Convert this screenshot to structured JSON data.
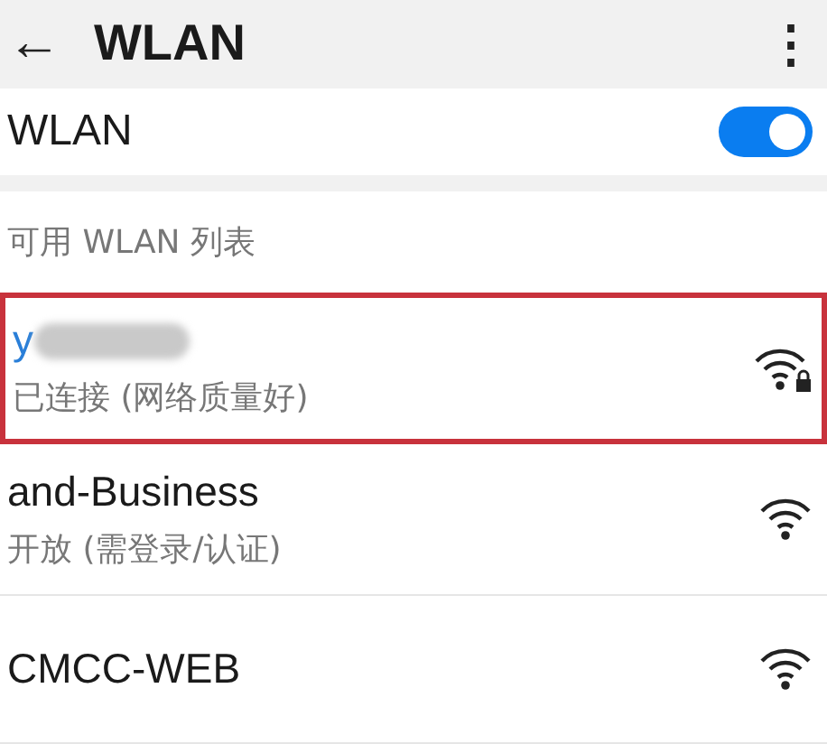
{
  "header": {
    "back": "←",
    "title": "WLAN",
    "menu": "⋮"
  },
  "wlan_toggle": {
    "label": "WLAN",
    "on": true
  },
  "section_title": "可用 WLAN 列表",
  "networks": [
    {
      "name": "y",
      "redacted": true,
      "status": "已连接 (网络质量好)",
      "selected": true,
      "highlighted": true,
      "secured": true
    },
    {
      "name": "and-Business",
      "redacted": false,
      "status": "开放 (需登录/认证)",
      "selected": false,
      "highlighted": false,
      "secured": false
    },
    {
      "name": "CMCC-WEB",
      "redacted": false,
      "selected": false,
      "highlighted": false,
      "secured": false
    }
  ]
}
